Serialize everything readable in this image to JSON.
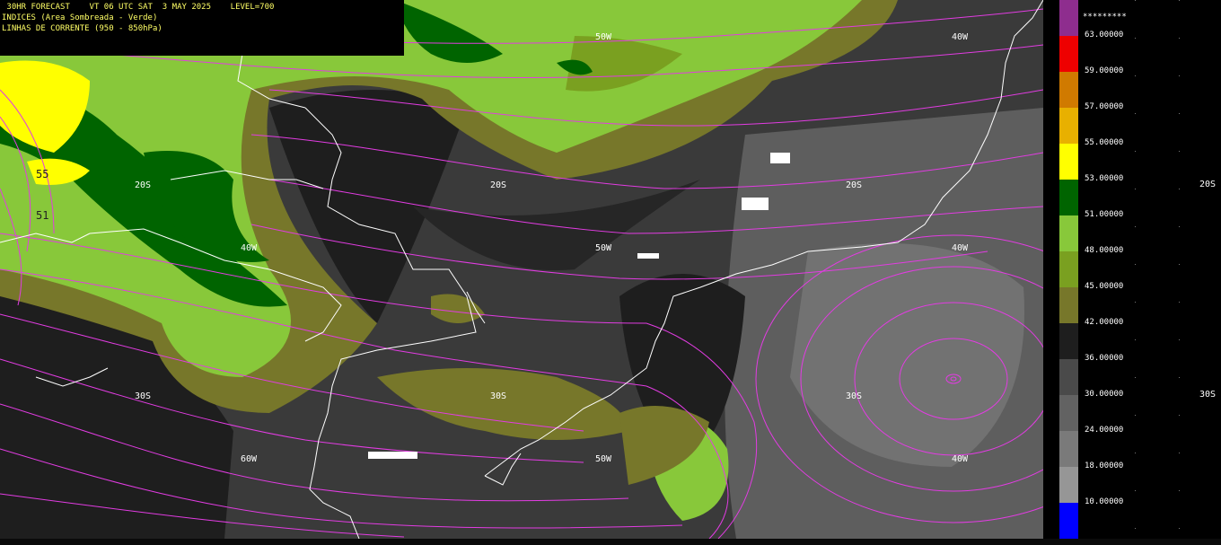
{
  "header": {
    "line1": " 30HR FORECAST    VT 06 UTC SAT  3 MAY 2025    LEVEL=700",
    "line2": "INDICES (Area Sombreada - Verde)",
    "line3": "LINHAS DE CORRENTE (950 - 850hPa)"
  },
  "map_labels": {
    "lon_50w_top": "50W",
    "lon_40w_top": "40W",
    "lat_20s_a": "20S",
    "lat_20s_b": "20S",
    "lat_20s_c": "20S",
    "lon_40w_mid": "40W",
    "lon_50w_mid": "50W",
    "lon_40w_mid2": "40W",
    "lat_30s_a": "30S",
    "lat_30s_b": "30S",
    "lat_30s_c": "30S",
    "lon_60w_bot": "60W",
    "lon_50w_bot": "50W",
    "lon_40w_bot": "40W",
    "edge_20s": "20S",
    "edge_30s": "30S",
    "contour_55": "55",
    "contour_51": "51"
  },
  "legend": {
    "overflow": "*********",
    "levels": [
      "63.00000",
      "59.00000",
      "57.00000",
      "55.00000",
      "53.00000",
      "51.00000",
      "48.00000",
      "45.00000",
      "42.00000",
      "36.00000",
      "30.00000",
      "24.00000",
      "18.00000",
      "10.00000"
    ],
    "colors": [
      "#8e2d8e",
      "#ee0000",
      "#d07a00",
      "#e8b000",
      "#ffff00",
      "#006400",
      "#88c83a",
      "#7aa020",
      "#77772a",
      "#1e1e1e",
      "#4a4a4a",
      "#626262",
      "#7a7a7a",
      "#969696",
      "#0000ff"
    ]
  },
  "colors": {
    "streamline": "#e23ce2",
    "coastline": "#ffffff",
    "gridlabel": "#ffffff"
  }
}
